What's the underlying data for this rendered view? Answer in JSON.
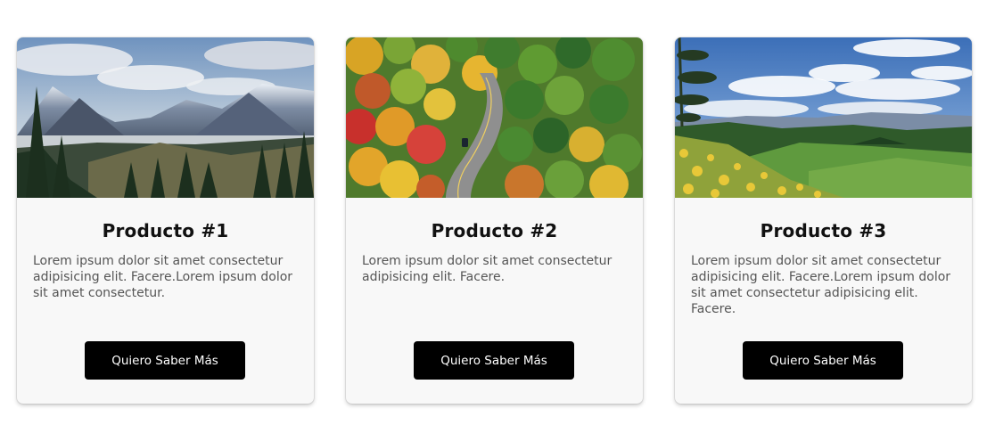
{
  "colors": {
    "card_background": "#f8f8f8",
    "button_background": "#000000",
    "button_text": "#ffffff",
    "title_text": "#111111",
    "body_text": "#555555"
  },
  "products": [
    {
      "title": "Producto #1",
      "description": "Lorem ipsum dolor sit amet consectetur adipisicing elit. Facere.Lorem ipsum dolor sit amet consectetur.",
      "button_label": "Quiero Saber Más",
      "image": "mountain-landscape-photo"
    },
    {
      "title": "Producto #2",
      "description": "Lorem ipsum dolor sit amet consectetur adipisicing elit. Facere.",
      "button_label": "Quiero Saber Más",
      "image": "autumn-forest-road-photo"
    },
    {
      "title": "Producto #3",
      "description": "Lorem ipsum dolor sit amet consectetur adipisicing elit. Facere.Lorem ipsum dolor sit amet consectetur adipisicing elit. Facere.",
      "button_label": "Quiero Saber Más",
      "image": "green-hills-meadow-photo"
    }
  ]
}
